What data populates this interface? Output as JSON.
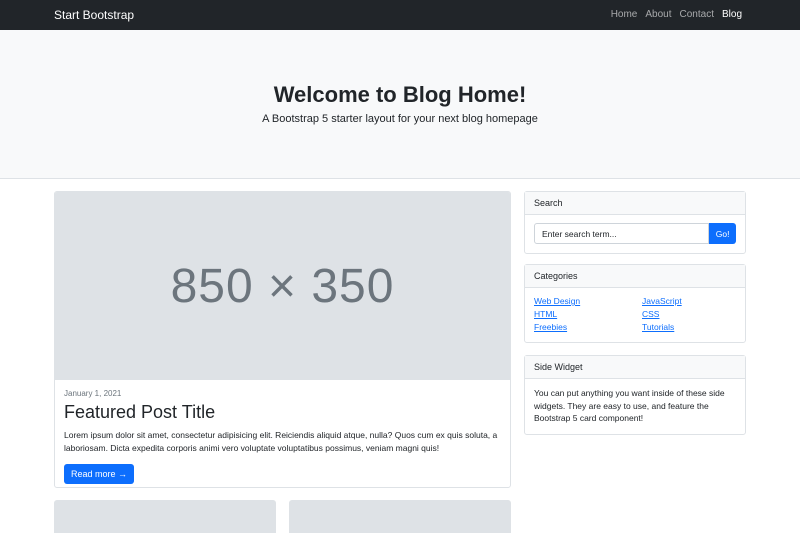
{
  "navbar": {
    "brand": "Start Bootstrap",
    "links": [
      {
        "label": "Home",
        "active": false
      },
      {
        "label": "About",
        "active": false
      },
      {
        "label": "Contact",
        "active": false
      },
      {
        "label": "Blog",
        "active": true
      }
    ]
  },
  "header": {
    "title": "Welcome to Blog Home!",
    "subtitle": "A Bootstrap 5 starter layout for your next blog homepage"
  },
  "featured_post": {
    "image_text": "850 × 350",
    "date": "January 1, 2021",
    "title": "Featured Post Title",
    "excerpt": "Lorem ipsum dolor sit amet, consectetur adipisicing elit. Reiciendis aliquid atque, nulla? Quos cum ex quis soluta, a laboriosam. Dicta expedita corporis animi vero voluptate voluptatibus possimus, veniam magni quis!",
    "read_more": "Read more →"
  },
  "sidebar": {
    "search": {
      "header": "Search",
      "placeholder": "Enter search term...",
      "button": "Go!"
    },
    "categories": {
      "header": "Categories",
      "items": [
        "Web Design",
        "JavaScript",
        "HTML",
        "CSS",
        "Freebies",
        "Tutorials"
      ]
    },
    "side_widget": {
      "header": "Side Widget",
      "text": "You can put anything you want inside of these side widgets. They are easy to use, and feature the Bootstrap 5 card component!"
    }
  },
  "colors": {
    "navbar_bg": "#212529",
    "header_bg": "#f8f9fa",
    "primary": "#0d6efd",
    "placeholder_bg": "#dee2e6"
  }
}
